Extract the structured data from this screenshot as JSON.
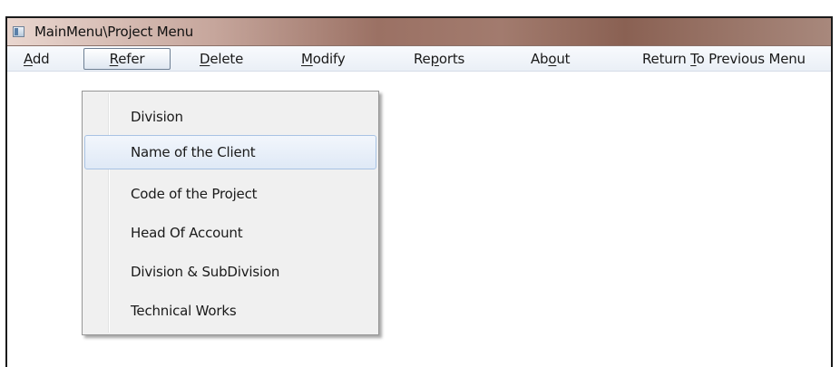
{
  "window": {
    "title": "MainMenu\\Project Menu"
  },
  "menubar": {
    "items": [
      {
        "pre": "",
        "key": "A",
        "post": "dd"
      },
      {
        "pre": "",
        "key": "R",
        "post": "efer"
      },
      {
        "pre": "",
        "key": "D",
        "post": "elete"
      },
      {
        "pre": "",
        "key": "M",
        "post": "odify"
      },
      {
        "pre": "Re",
        "key": "p",
        "post": "orts"
      },
      {
        "pre": "Ab",
        "key": "o",
        "post": "ut"
      },
      {
        "pre": "Return ",
        "key": "T",
        "post": "o Previous Menu"
      }
    ]
  },
  "refer_menu": {
    "items": [
      {
        "label": "Division"
      },
      {
        "label": "Name of the Client"
      },
      {
        "label": "Code of the Project"
      },
      {
        "label": "Head Of Account"
      },
      {
        "label": "Division & SubDivision"
      },
      {
        "label": "Technical Works"
      }
    ]
  },
  "icons": {
    "app": "application-icon"
  }
}
